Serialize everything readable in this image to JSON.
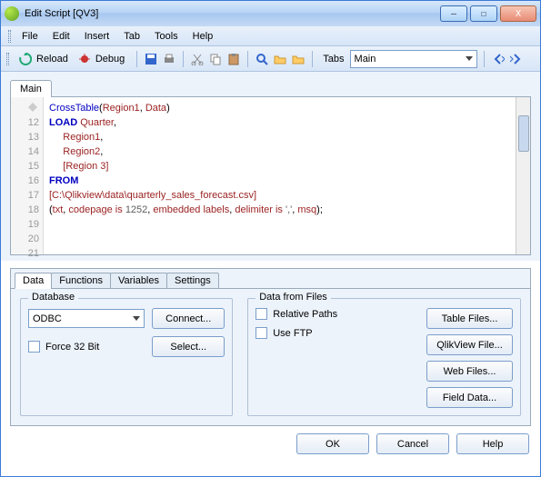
{
  "window": {
    "title": "Edit Script [QV3]"
  },
  "menus": [
    "File",
    "Edit",
    "Insert",
    "Tab",
    "Tools",
    "Help"
  ],
  "toolbar": {
    "reload": "Reload",
    "debug": "Debug",
    "tabs_label": "Tabs",
    "tabs_value": "Main"
  },
  "editor": {
    "tab": "Main",
    "line_start": 12,
    "lines": [
      {
        "n": 12,
        "html": "<span class='fn'>CrossTable</span>(<span class='id'>Region1</span>, <span class='id'>Data</span>)"
      },
      {
        "n": 13,
        "html": "<span class='kw'>LOAD</span> <span class='id'>Quarter</span>,"
      },
      {
        "n": 14,
        "html": "     <span class='id'>Region1</span>,"
      },
      {
        "n": 15,
        "html": "     <span class='id'>Region2</span>,"
      },
      {
        "n": 16,
        "html": "     <span class='id'>[Region 3]</span>"
      },
      {
        "n": 17,
        "html": "<span class='kw'>FROM</span>"
      },
      {
        "n": 18,
        "html": "<span class='id'>[C:\\Qlikview\\data\\quarterly_sales_forecast.csv]</span>"
      },
      {
        "n": 19,
        "html": "(<span class='id'>txt</span>, <span class='id'>codepage is</span> <span class='str'>1252</span>, <span class='id'>embedded labels</span>, <span class='id'>delimiter is</span> <span class='str'>','</span>, <span class='id'>msq</span>);"
      },
      {
        "n": 20,
        "html": ""
      },
      {
        "n": 21,
        "html": ""
      }
    ]
  },
  "panel": {
    "tabs": [
      "Data",
      "Functions",
      "Variables",
      "Settings"
    ],
    "database": {
      "legend": "Database",
      "driver": "ODBC",
      "connect": "Connect...",
      "select": "Select...",
      "force32": "Force 32 Bit"
    },
    "files": {
      "legend": "Data from Files",
      "relative": "Relative Paths",
      "useftp": "Use FTP",
      "table_files": "Table Files...",
      "qlik_file": "QlikView File...",
      "web_files": "Web Files...",
      "field_data": "Field Data..."
    }
  },
  "footer": {
    "ok": "OK",
    "cancel": "Cancel",
    "help": "Help"
  }
}
